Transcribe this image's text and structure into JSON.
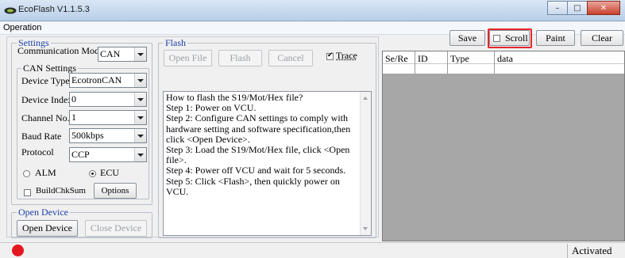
{
  "window": {
    "title": "EcoFlash V1.1.5.3",
    "min": "–",
    "max": "□",
    "close": "✕"
  },
  "menu": {
    "items": [
      "Operation"
    ]
  },
  "settings": {
    "legend": "Settings",
    "comm_mode_label": "Communication Mode",
    "comm_mode_value": "CAN",
    "can_legend": "CAN Settings",
    "device_type_label": "Device Type",
    "device_type_value": "EcotronCAN",
    "device_index_label": "Device Index",
    "device_index_value": "0",
    "channel_label": "Channel No.",
    "channel_value": "1",
    "baud_label": "Baud Rate",
    "baud_value": "500kbps",
    "protocol_label": "Protocol",
    "protocol_value": "CCP",
    "radio_alm": "ALM",
    "radio_ecu": "ECU",
    "selected_radio": "ECU",
    "buildchk_label": "BuildChkSum",
    "buildchk_checked": false,
    "options_button": "Options"
  },
  "open_device": {
    "legend": "Open Device",
    "open_button": "Open Device",
    "close_button": "Close Device"
  },
  "flash": {
    "legend": "Flash",
    "open_file_button": "Open File",
    "flash_button": "Flash",
    "cancel_button": "Cancel",
    "trace_label": "Trace",
    "trace_checked": true,
    "help_lines": [
      "How to flash the S19/Mot/Hex file?",
      "Step 1: Power on VCU.",
      "Step 2: Configure CAN settings to comply with hardware setting and software specification,then click <Open Device>.",
      "Step 3: Load the S19/Mot/Hex file, click <Open file>.",
      "Step 4: Power off VCU and wait for 5 seconds.",
      "Step 5: Click <Flash>, then quickly power on VCU."
    ]
  },
  "log": {
    "save_button": "Save",
    "scroll_label": "Scroll",
    "scroll_checked": false,
    "paint_button": "Paint",
    "clear_button": "Clear",
    "columns": [
      "Se/Re",
      "ID",
      "Type",
      "data"
    ]
  },
  "status": {
    "text": "Activated",
    "led_color": "#e3181f"
  },
  "colors": {
    "legend": "#1a3fa8",
    "highlight": "#e4262c",
    "grid_bg": "#a7a7a7"
  }
}
